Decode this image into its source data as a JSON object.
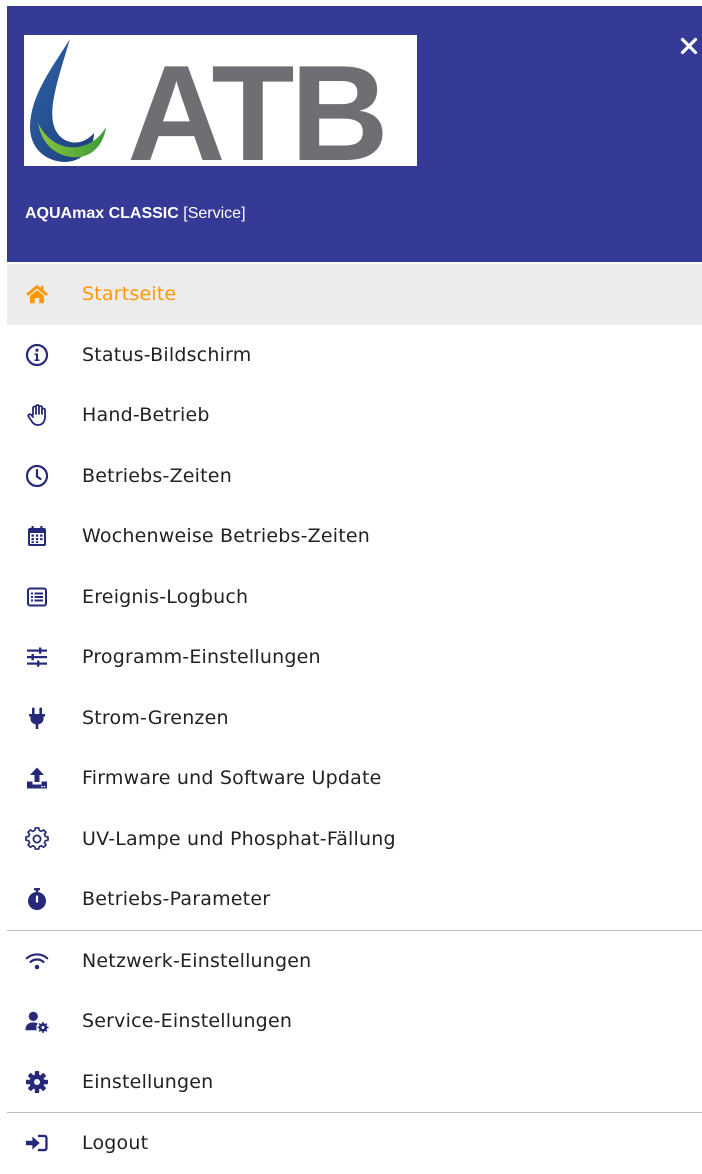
{
  "colors": {
    "header_bg": "#343a95",
    "accent": "#ff9800",
    "text": "#222222",
    "active_bg": "#ececec"
  },
  "header": {
    "logo_text": "ATB",
    "device_model": "AQUAmax CLASSIC",
    "device_mode": "[Service]",
    "close_icon": "close-icon"
  },
  "menu": {
    "items": [
      {
        "label": "Startseite",
        "icon": "home-icon",
        "active": true
      },
      {
        "label": "Status-Bildschirm",
        "icon": "info-icon"
      },
      {
        "label": "Hand-Betrieb",
        "icon": "hand-icon"
      },
      {
        "label": "Betriebs-Zeiten",
        "icon": "clock-icon"
      },
      {
        "label": "Wochenweise Betriebs-Zeiten",
        "icon": "calendar-icon"
      },
      {
        "label": "Ereignis-Logbuch",
        "icon": "list-icon"
      },
      {
        "label": "Programm-Einstellungen",
        "icon": "sliders-icon"
      },
      {
        "label": "Strom-Grenzen",
        "icon": "plug-icon"
      },
      {
        "label": "Firmware und Software Update",
        "icon": "upload-icon"
      },
      {
        "label": "UV-Lampe und Phosphat-Fällung",
        "icon": "gear-outline-icon"
      },
      {
        "label": "Betriebs-Parameter",
        "icon": "stopwatch-icon"
      },
      {
        "label": "Netzwerk-Einstellungen",
        "icon": "wifi-icon"
      },
      {
        "label": "Service-Einstellungen",
        "icon": "user-gear-icon"
      },
      {
        "label": "Einstellungen",
        "icon": "gear-icon"
      },
      {
        "label": "Logout",
        "icon": "logout-icon"
      }
    ]
  }
}
